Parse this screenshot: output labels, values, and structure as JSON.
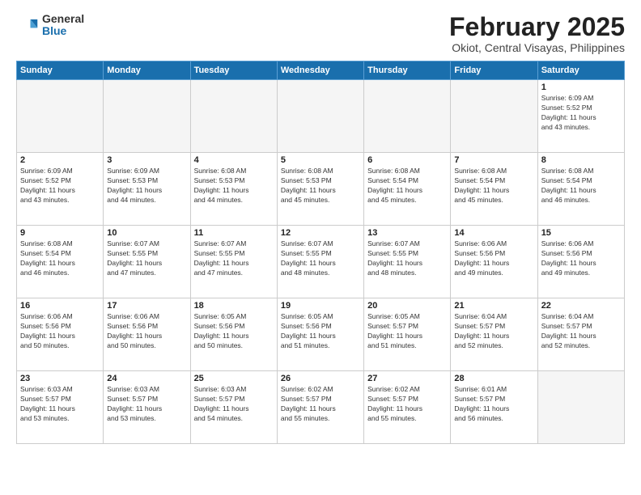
{
  "header": {
    "logo_general": "General",
    "logo_blue": "Blue",
    "title": "February 2025",
    "location": "Okiot, Central Visayas, Philippines"
  },
  "weekdays": [
    "Sunday",
    "Monday",
    "Tuesday",
    "Wednesday",
    "Thursday",
    "Friday",
    "Saturday"
  ],
  "weeks": [
    [
      {
        "day": "",
        "info": ""
      },
      {
        "day": "",
        "info": ""
      },
      {
        "day": "",
        "info": ""
      },
      {
        "day": "",
        "info": ""
      },
      {
        "day": "",
        "info": ""
      },
      {
        "day": "",
        "info": ""
      },
      {
        "day": "1",
        "info": "Sunrise: 6:09 AM\nSunset: 5:52 PM\nDaylight: 11 hours\nand 43 minutes."
      }
    ],
    [
      {
        "day": "2",
        "info": "Sunrise: 6:09 AM\nSunset: 5:52 PM\nDaylight: 11 hours\nand 43 minutes."
      },
      {
        "day": "3",
        "info": "Sunrise: 6:09 AM\nSunset: 5:53 PM\nDaylight: 11 hours\nand 44 minutes."
      },
      {
        "day": "4",
        "info": "Sunrise: 6:08 AM\nSunset: 5:53 PM\nDaylight: 11 hours\nand 44 minutes."
      },
      {
        "day": "5",
        "info": "Sunrise: 6:08 AM\nSunset: 5:53 PM\nDaylight: 11 hours\nand 45 minutes."
      },
      {
        "day": "6",
        "info": "Sunrise: 6:08 AM\nSunset: 5:54 PM\nDaylight: 11 hours\nand 45 minutes."
      },
      {
        "day": "7",
        "info": "Sunrise: 6:08 AM\nSunset: 5:54 PM\nDaylight: 11 hours\nand 45 minutes."
      },
      {
        "day": "8",
        "info": "Sunrise: 6:08 AM\nSunset: 5:54 PM\nDaylight: 11 hours\nand 46 minutes."
      }
    ],
    [
      {
        "day": "9",
        "info": "Sunrise: 6:08 AM\nSunset: 5:54 PM\nDaylight: 11 hours\nand 46 minutes."
      },
      {
        "day": "10",
        "info": "Sunrise: 6:07 AM\nSunset: 5:55 PM\nDaylight: 11 hours\nand 47 minutes."
      },
      {
        "day": "11",
        "info": "Sunrise: 6:07 AM\nSunset: 5:55 PM\nDaylight: 11 hours\nand 47 minutes."
      },
      {
        "day": "12",
        "info": "Sunrise: 6:07 AM\nSunset: 5:55 PM\nDaylight: 11 hours\nand 48 minutes."
      },
      {
        "day": "13",
        "info": "Sunrise: 6:07 AM\nSunset: 5:55 PM\nDaylight: 11 hours\nand 48 minutes."
      },
      {
        "day": "14",
        "info": "Sunrise: 6:06 AM\nSunset: 5:56 PM\nDaylight: 11 hours\nand 49 minutes."
      },
      {
        "day": "15",
        "info": "Sunrise: 6:06 AM\nSunset: 5:56 PM\nDaylight: 11 hours\nand 49 minutes."
      }
    ],
    [
      {
        "day": "16",
        "info": "Sunrise: 6:06 AM\nSunset: 5:56 PM\nDaylight: 11 hours\nand 50 minutes."
      },
      {
        "day": "17",
        "info": "Sunrise: 6:06 AM\nSunset: 5:56 PM\nDaylight: 11 hours\nand 50 minutes."
      },
      {
        "day": "18",
        "info": "Sunrise: 6:05 AM\nSunset: 5:56 PM\nDaylight: 11 hours\nand 50 minutes."
      },
      {
        "day": "19",
        "info": "Sunrise: 6:05 AM\nSunset: 5:56 PM\nDaylight: 11 hours\nand 51 minutes."
      },
      {
        "day": "20",
        "info": "Sunrise: 6:05 AM\nSunset: 5:57 PM\nDaylight: 11 hours\nand 51 minutes."
      },
      {
        "day": "21",
        "info": "Sunrise: 6:04 AM\nSunset: 5:57 PM\nDaylight: 11 hours\nand 52 minutes."
      },
      {
        "day": "22",
        "info": "Sunrise: 6:04 AM\nSunset: 5:57 PM\nDaylight: 11 hours\nand 52 minutes."
      }
    ],
    [
      {
        "day": "23",
        "info": "Sunrise: 6:03 AM\nSunset: 5:57 PM\nDaylight: 11 hours\nand 53 minutes."
      },
      {
        "day": "24",
        "info": "Sunrise: 6:03 AM\nSunset: 5:57 PM\nDaylight: 11 hours\nand 53 minutes."
      },
      {
        "day": "25",
        "info": "Sunrise: 6:03 AM\nSunset: 5:57 PM\nDaylight: 11 hours\nand 54 minutes."
      },
      {
        "day": "26",
        "info": "Sunrise: 6:02 AM\nSunset: 5:57 PM\nDaylight: 11 hours\nand 55 minutes."
      },
      {
        "day": "27",
        "info": "Sunrise: 6:02 AM\nSunset: 5:57 PM\nDaylight: 11 hours\nand 55 minutes."
      },
      {
        "day": "28",
        "info": "Sunrise: 6:01 AM\nSunset: 5:57 PM\nDaylight: 11 hours\nand 56 minutes."
      },
      {
        "day": "",
        "info": ""
      }
    ]
  ]
}
